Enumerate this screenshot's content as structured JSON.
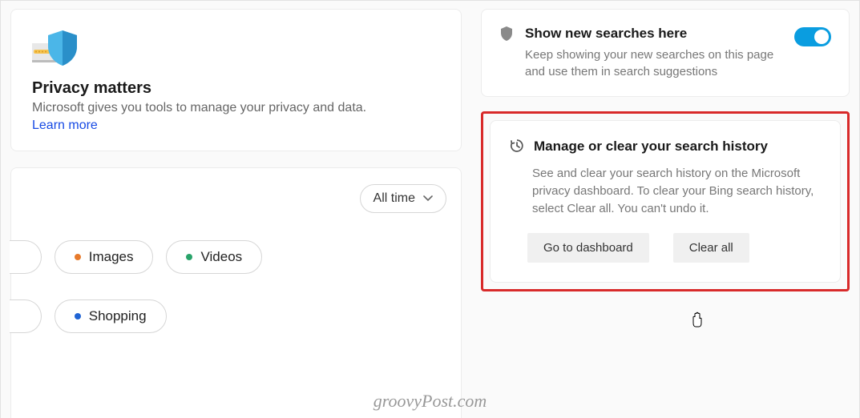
{
  "privacy": {
    "heading": "Privacy matters",
    "description": "Microsoft gives you tools to manage your privacy and data.",
    "learn_more": "Learn more"
  },
  "filter": {
    "dropdown_label": "All time"
  },
  "chips": {
    "images": "Images",
    "videos": "Videos",
    "shopping": "Shopping"
  },
  "show_searches": {
    "title": "Show new searches here",
    "description": "Keep showing your new searches on this page and use them in search suggestions"
  },
  "manage": {
    "title": "Manage or clear your search history",
    "description": "See and clear your search history on the Microsoft privacy dashboard. To clear your Bing search history, select Clear all. You can't undo it.",
    "dashboard_btn": "Go to dashboard",
    "clear_btn": "Clear all"
  },
  "watermark": "groovyPost.com"
}
